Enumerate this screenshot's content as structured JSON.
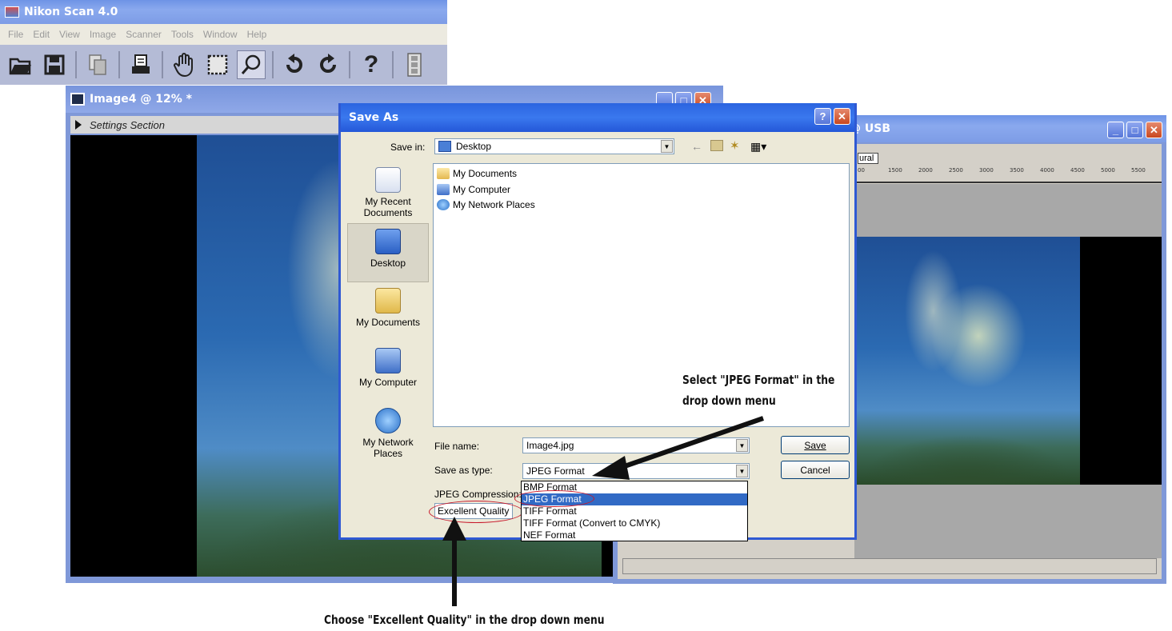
{
  "app": {
    "title": "Nikon Scan 4.0",
    "menu": [
      "File",
      "Edit",
      "View",
      "Image",
      "Scanner",
      "Tools",
      "Window",
      "Help"
    ],
    "toolbar_icons": [
      "open-folder-icon",
      "save-icon",
      "copy-icon",
      "print-icon",
      "hand-tool-icon",
      "crop-icon",
      "zoom-icon",
      "rotate-left-icon",
      "rotate-right-icon",
      "help-icon",
      "filmstrip-icon"
    ]
  },
  "image_window": {
    "title": "Image4 @ 12% *",
    "settings_section": "Settings Section"
  },
  "scanner_window": {
    "title_partial": "@ USB",
    "tab_partial": "ural",
    "ruler_ticks": [
      "00",
      "1500",
      "2000",
      "2500",
      "3000",
      "3500",
      "4000",
      "4500",
      "5000",
      "5500"
    ]
  },
  "dialog": {
    "title": "Save As",
    "save_in_label": "Save in:",
    "save_in_value": "Desktop",
    "places": [
      {
        "label": "My Recent Documents",
        "icon": "recent-documents-icon"
      },
      {
        "label": "Desktop",
        "icon": "desktop-icon"
      },
      {
        "label": "My Documents",
        "icon": "my-documents-icon"
      },
      {
        "label": "My Computer",
        "icon": "my-computer-icon"
      },
      {
        "label": "My Network Places",
        "icon": "network-places-icon"
      }
    ],
    "files": [
      "My Documents",
      "My Computer",
      "My Network Places"
    ],
    "file_name_label": "File name:",
    "file_name_value": "Image4.jpg",
    "save_type_label": "Save as type:",
    "save_type_value": "JPEG Format",
    "save_button": "Save",
    "cancel_button": "Cancel",
    "jpeg_compression_label": "JPEG Compression:",
    "quality_value": "Excellent Quality",
    "type_options": [
      "BMP Format",
      "JPEG Format",
      "TIFF Format",
      "TIFF Format (Convert to CMYK)",
      "NEF Format"
    ],
    "selected_type_index": 1
  },
  "annotations": {
    "jpeg_note_line1": "Select \"JPEG Format\" in the",
    "jpeg_note_line2": "drop down menu",
    "quality_note": "Choose \"Excellent Quality\" in the drop down menu"
  },
  "colors": {
    "xp_blue": "#2b64e0",
    "selection": "#316ac5",
    "highlight_oval": "#c8182a"
  }
}
